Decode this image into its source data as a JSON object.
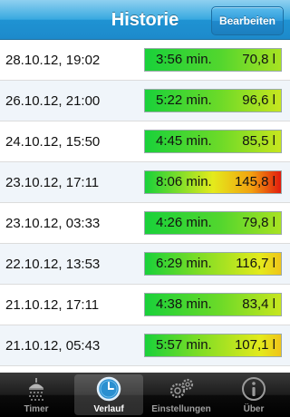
{
  "nav": {
    "title": "Historie",
    "edit_label": "Bearbeiten"
  },
  "history": [
    {
      "date": "28.10.12, 19:02",
      "duration": "3:56 min.",
      "volume": "70,8 l",
      "liters": 70.8
    },
    {
      "date": "26.10.12, 21:00",
      "duration": "5:22 min.",
      "volume": "96,6 l",
      "liters": 96.6
    },
    {
      "date": "24.10.12, 15:50",
      "duration": "4:45 min.",
      "volume": "85,5 l",
      "liters": 85.5
    },
    {
      "date": "23.10.12, 17:11",
      "duration": "8:06 min.",
      "volume": "145,8 l",
      "liters": 145.8
    },
    {
      "date": "23.10.12, 03:33",
      "duration": "4:26 min.",
      "volume": "79,8 l",
      "liters": 79.8
    },
    {
      "date": "22.10.12, 13:53",
      "duration": "6:29 min.",
      "volume": "116,7 l",
      "liters": 116.7
    },
    {
      "date": "21.10.12, 17:11",
      "duration": "4:38 min.",
      "volume": "83,4 l",
      "liters": 83.4
    },
    {
      "date": "21.10.12, 05:43",
      "duration": "5:57 min.",
      "volume": "107,1 l",
      "liters": 107.1
    }
  ],
  "colors": {
    "green": "#19d13a",
    "yellow": "#e4ea1c",
    "orange": "#f2a20f",
    "red": "#e21b0e"
  },
  "tabs": [
    {
      "label": "Timer",
      "icon": "shower-icon",
      "active": false
    },
    {
      "label": "Verlauf",
      "icon": "clock-icon",
      "active": true
    },
    {
      "label": "Einstellungen",
      "icon": "gears-icon",
      "active": false
    },
    {
      "label": "Über",
      "icon": "info-icon",
      "active": false
    }
  ]
}
